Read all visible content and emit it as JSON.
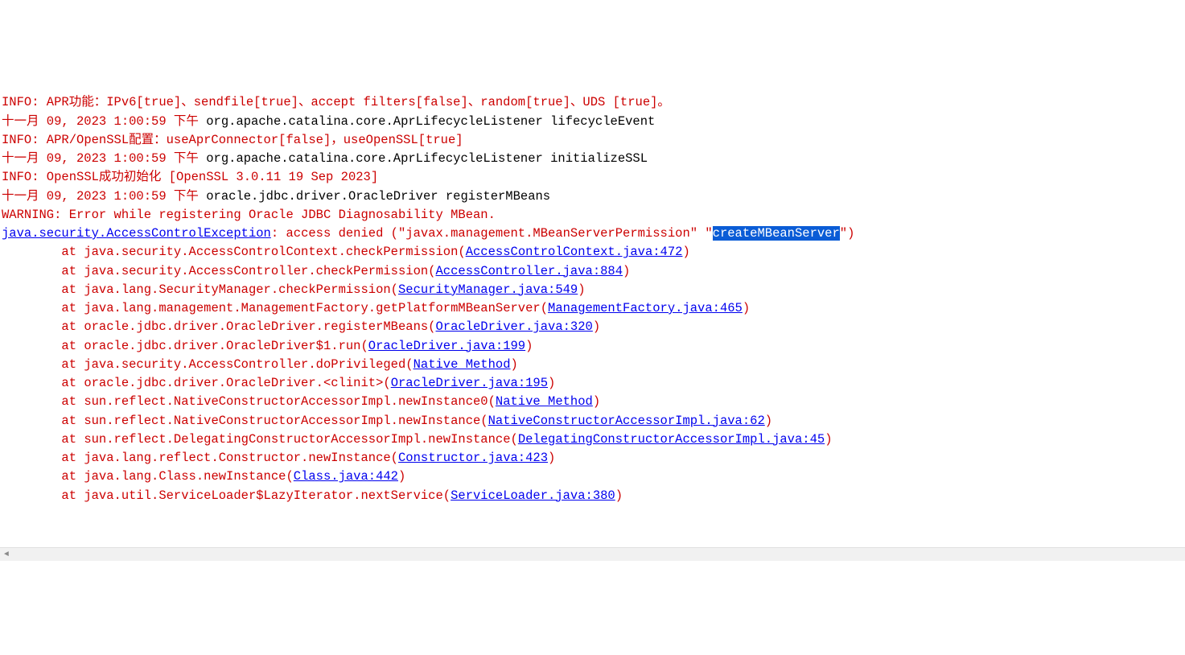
{
  "lines": [
    {
      "segments": [
        {
          "cls": "red",
          "text": "INFO: APR功能：IPv6[true]、sendfile[true]、accept filters[false]、random[true]、UDS [true]。"
        }
      ]
    },
    {
      "segments": [
        {
          "cls": "red",
          "text": "十一月 09, 2023 1:00:59 下午 "
        },
        {
          "cls": "black",
          "text": "org.apache.catalina.core.AprLifecycleListener lifecycleEvent"
        }
      ]
    },
    {
      "segments": [
        {
          "cls": "red",
          "text": "INFO: APR/OpenSSL配置：useAprConnector[false]，useOpenSSL[true]"
        }
      ]
    },
    {
      "segments": [
        {
          "cls": "red",
          "text": "十一月 09, 2023 1:00:59 下午 "
        },
        {
          "cls": "black",
          "text": "org.apache.catalina.core.AprLifecycleListener initializeSSL"
        }
      ]
    },
    {
      "segments": [
        {
          "cls": "red",
          "text": "INFO: OpenSSL成功初始化 [OpenSSL 3.0.11 19 Sep 2023]"
        }
      ]
    },
    {
      "segments": [
        {
          "cls": "red",
          "text": "十一月 09, 2023 1:00:59 下午 "
        },
        {
          "cls": "black",
          "text": "oracle.jdbc.driver.OracleDriver registerMBeans"
        }
      ]
    },
    {
      "segments": [
        {
          "cls": "red",
          "text": "WARNING: Error while registering Oracle JDBC Diagnosability MBean."
        }
      ]
    },
    {
      "segments": [
        {
          "cls": "link",
          "text": "java.security.AccessControlException"
        },
        {
          "cls": "red",
          "text": ": access denied (\"javax.management.MBeanServerPermission\" \""
        },
        {
          "cls": "highlight",
          "text": "createMBeanServer"
        },
        {
          "cls": "red",
          "text": "\")"
        }
      ]
    },
    {
      "segments": [
        {
          "cls": "red",
          "text": "        at java.security.AccessControlContext.checkPermission("
        },
        {
          "cls": "link",
          "text": "AccessControlContext.java:472"
        },
        {
          "cls": "red",
          "text": ")"
        }
      ]
    },
    {
      "segments": [
        {
          "cls": "red",
          "text": "        at java.security.AccessController.checkPermission("
        },
        {
          "cls": "link",
          "text": "AccessController.java:884"
        },
        {
          "cls": "red",
          "text": ")"
        }
      ]
    },
    {
      "segments": [
        {
          "cls": "red",
          "text": "        at java.lang.SecurityManager.checkPermission("
        },
        {
          "cls": "link",
          "text": "SecurityManager.java:549"
        },
        {
          "cls": "red",
          "text": ")"
        }
      ]
    },
    {
      "segments": [
        {
          "cls": "red",
          "text": "        at java.lang.management.ManagementFactory.getPlatformMBeanServer("
        },
        {
          "cls": "link",
          "text": "ManagementFactory.java:465"
        },
        {
          "cls": "red",
          "text": ")"
        }
      ]
    },
    {
      "segments": [
        {
          "cls": "red",
          "text": "        at oracle.jdbc.driver.OracleDriver.registerMBeans("
        },
        {
          "cls": "link",
          "text": "OracleDriver.java:320"
        },
        {
          "cls": "red",
          "text": ")"
        }
      ]
    },
    {
      "segments": [
        {
          "cls": "red",
          "text": "        at oracle.jdbc.driver.OracleDriver$1.run("
        },
        {
          "cls": "link",
          "text": "OracleDriver.java:199"
        },
        {
          "cls": "red",
          "text": ")"
        }
      ]
    },
    {
      "segments": [
        {
          "cls": "red",
          "text": "        at java.security.AccessController.doPrivileged("
        },
        {
          "cls": "link",
          "text": "Native Method"
        },
        {
          "cls": "red",
          "text": ")"
        }
      ]
    },
    {
      "segments": [
        {
          "cls": "red",
          "text": "        at oracle.jdbc.driver.OracleDriver.<clinit>("
        },
        {
          "cls": "link",
          "text": "OracleDriver.java:195"
        },
        {
          "cls": "red",
          "text": ")"
        }
      ]
    },
    {
      "segments": [
        {
          "cls": "red",
          "text": "        at sun.reflect.NativeConstructorAccessorImpl.newInstance0("
        },
        {
          "cls": "link",
          "text": "Native Method"
        },
        {
          "cls": "red",
          "text": ")"
        }
      ]
    },
    {
      "segments": [
        {
          "cls": "red",
          "text": "        at sun.reflect.NativeConstructorAccessorImpl.newInstance("
        },
        {
          "cls": "link",
          "text": "NativeConstructorAccessorImpl.java:62"
        },
        {
          "cls": "red",
          "text": ")"
        }
      ]
    },
    {
      "segments": [
        {
          "cls": "red",
          "text": "        at sun.reflect.DelegatingConstructorAccessorImpl.newInstance("
        },
        {
          "cls": "link",
          "text": "DelegatingConstructorAccessorImpl.java:45"
        },
        {
          "cls": "red",
          "text": ")"
        }
      ]
    },
    {
      "segments": [
        {
          "cls": "red",
          "text": "        at java.lang.reflect.Constructor.newInstance("
        },
        {
          "cls": "link",
          "text": "Constructor.java:423"
        },
        {
          "cls": "red",
          "text": ")"
        }
      ]
    },
    {
      "segments": [
        {
          "cls": "red",
          "text": "        at java.lang.Class.newInstance("
        },
        {
          "cls": "link",
          "text": "Class.java:442"
        },
        {
          "cls": "red",
          "text": ")"
        }
      ]
    },
    {
      "segments": [
        {
          "cls": "red",
          "text": "        at java.util.ServiceLoader$LazyIterator.nextService("
        },
        {
          "cls": "link",
          "text": "ServiceLoader.java:380"
        },
        {
          "cls": "red",
          "text": ")"
        }
      ]
    }
  ],
  "scroll_arrow": "◄"
}
